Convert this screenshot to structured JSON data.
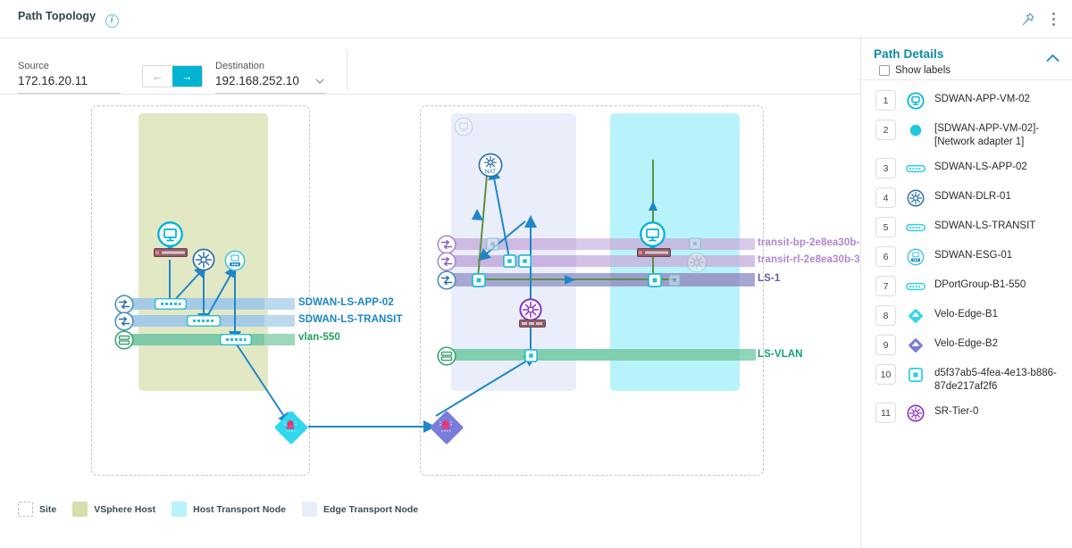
{
  "header": {
    "title": "Path Topology",
    "info_icon": "info-icon",
    "pin_icon": "pin-icon",
    "more_icon": "more-vertical-icon"
  },
  "toolbar": {
    "source": {
      "label": "Source",
      "value": "172.16.20.11"
    },
    "destination": {
      "label": "Destination",
      "value": "192.168.252.10"
    },
    "direction": {
      "back_label": "←",
      "forward_label": "→",
      "active": "forward"
    },
    "dropdown_icon": "chevron-down-icon"
  },
  "canvas": {
    "segments": [
      {
        "name": "SDWAN-LS-APP-02",
        "color": "#1a85c8",
        "swatch": "#a7cbe8"
      },
      {
        "name": "SDWAN-LS-TRANSIT",
        "color": "#1a85c8",
        "swatch": "#a7cbe8"
      },
      {
        "name": "vlan-550",
        "color": "#21a35f",
        "swatch": "#8fd4ad"
      },
      {
        "name": "transit-bp-2e8ea30b-",
        "color": "#b186d1",
        "swatch": "#d9c8ea"
      },
      {
        "name": "transit-rl-2e8ea30b-3",
        "color": "#b186d1",
        "swatch": "#d9c8ea"
      },
      {
        "name": "LS-1",
        "color": "#5e5ea8",
        "swatch": "#a9a9d6"
      },
      {
        "name": "LS-VLAN",
        "color": "#13a06a",
        "swatch": "#7ed0ac"
      }
    ],
    "nodes": {
      "nat_label": "NAT"
    }
  },
  "legend": {
    "items": [
      {
        "label": "Site",
        "color": "dashed"
      },
      {
        "label": "VSphere Host",
        "color": "#d5dfab"
      },
      {
        "label": "Host Transport Node",
        "color": "#b8f3fb"
      },
      {
        "label": "Edge Transport Node",
        "color": "#e8edfa"
      }
    ]
  },
  "panel": {
    "title": "Path Details",
    "collapse_icon": "chevron-up-icon",
    "show_labels": {
      "label": "Show labels",
      "checked": false
    },
    "items": [
      {
        "num": "1",
        "icon": "vm-icon",
        "label": "SDWAN-APP-VM-02"
      },
      {
        "num": "2",
        "icon": "dot-icon",
        "label": "[SDWAN-APP-VM-02]-[Network adapter 1]"
      },
      {
        "num": "3",
        "icon": "switch-icon",
        "label": "SDWAN-LS-APP-02"
      },
      {
        "num": "4",
        "icon": "router-icon",
        "label": "SDWAN-DLR-01"
      },
      {
        "num": "5",
        "icon": "switch-icon",
        "label": "SDWAN-LS-TRANSIT"
      },
      {
        "num": "6",
        "icon": "edge-gateway-icon",
        "label": "SDWAN-ESG-01"
      },
      {
        "num": "7",
        "icon": "switch-icon",
        "label": "DPortGroup-B1-550"
      },
      {
        "num": "8",
        "icon": "diamond-cyan-icon",
        "label": "Velo-Edge-B1"
      },
      {
        "num": "9",
        "icon": "diamond-purple-icon",
        "label": "Velo-Edge-B2"
      },
      {
        "num": "10",
        "icon": "port-icon",
        "label": "d5f37ab5-4fea-4e13-b886-87de217af2f6"
      },
      {
        "num": "11",
        "icon": "sr-tier-icon",
        "label": "SR-Tier-0"
      }
    ]
  }
}
